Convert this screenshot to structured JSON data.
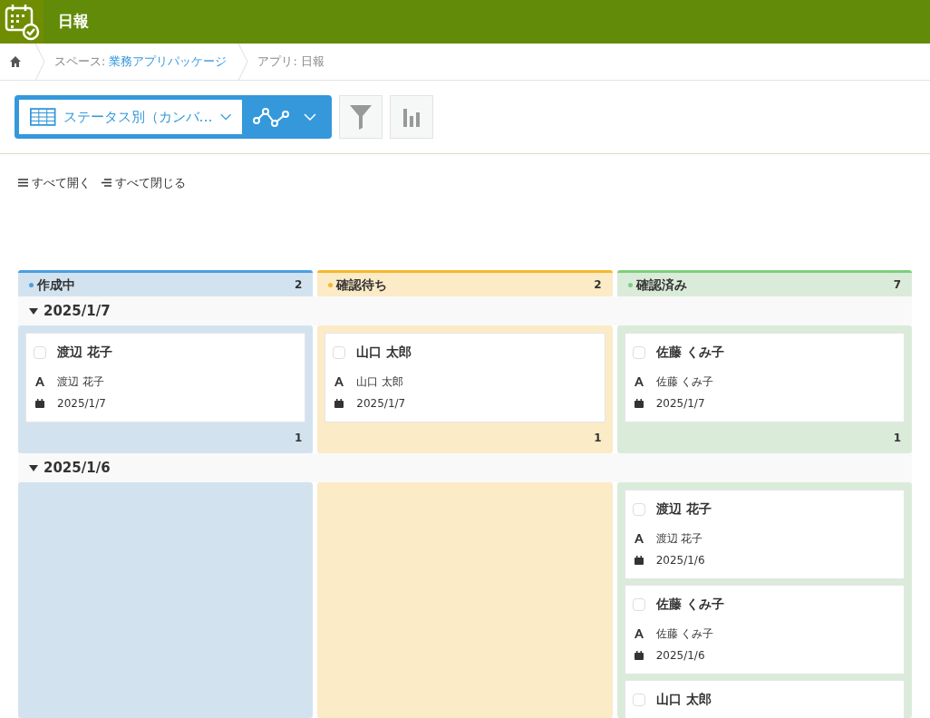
{
  "header": {
    "title": "日報"
  },
  "breadcrumb": [
    {
      "label": "スペース: ",
      "link": "業務アプリパッケージ"
    },
    {
      "label": "アプリ: 日報"
    }
  ],
  "view_selector": {
    "label": "ステータス別（カンバ…"
  },
  "actions": [
    "すべて開く",
    "すべて閉じる"
  ],
  "columns": [
    {
      "name": "作成中",
      "count": "2",
      "color": "#4a9fe0"
    },
    {
      "name": "確認待ち",
      "count": "2",
      "color": "#f5b82e"
    },
    {
      "name": "確認済み",
      "count": "7",
      "color": "#7dcf7d"
    }
  ],
  "groups": [
    {
      "date": "2025/1/7",
      "expanded": true,
      "lanes": [
        {
          "kind": "cards",
          "count": "1",
          "cards": [
            {
              "title": "渡辺 花子",
              "checked": false,
              "fields": [
                {
                  "kind": "user",
                  "text": "渡辺 花子"
                },
                {
                  "kind": "date",
                  "text": "2025/1/7"
                }
              ]
            }
          ]
        },
        {
          "kind": "cards",
          "count": "1",
          "cards": [
            {
              "title": "山口 太郎",
              "checked": false,
              "fields": [
                {
                  "kind": "user",
                  "text": "山口 太郎"
                },
                {
                  "kind": "date",
                  "text": "2025/1/7"
                }
              ]
            }
          ]
        },
        {
          "kind": "cards",
          "count": "1",
          "cards": [
            {
              "title": "佐藤 くみ子",
              "checked": false,
              "fields": [
                {
                  "kind": "user",
                  "text": "佐藤 くみ子"
                },
                {
                  "kind": "date",
                  "text": "2025/1/7"
                }
              ]
            }
          ]
        }
      ]
    },
    {
      "date": "2025/1/6",
      "expanded": true,
      "lanes": [
        {
          "kind": "empty"
        },
        {
          "kind": "empty"
        },
        {
          "kind": "cards",
          "cards": [
            {
              "title": "渡辺 花子",
              "checked": false,
              "fields": [
                {
                  "kind": "user",
                  "text": "渡辺 花子"
                },
                {
                  "kind": "date",
                  "text": "2025/1/6"
                }
              ]
            },
            {
              "title": "佐藤 くみ子",
              "checked": false,
              "fields": [
                {
                  "kind": "user",
                  "text": "佐藤 くみ子"
                },
                {
                  "kind": "date",
                  "text": "2025/1/6"
                }
              ]
            },
            {
              "title": "山口 太郎",
              "checked": false
            }
          ]
        }
      ]
    }
  ]
}
